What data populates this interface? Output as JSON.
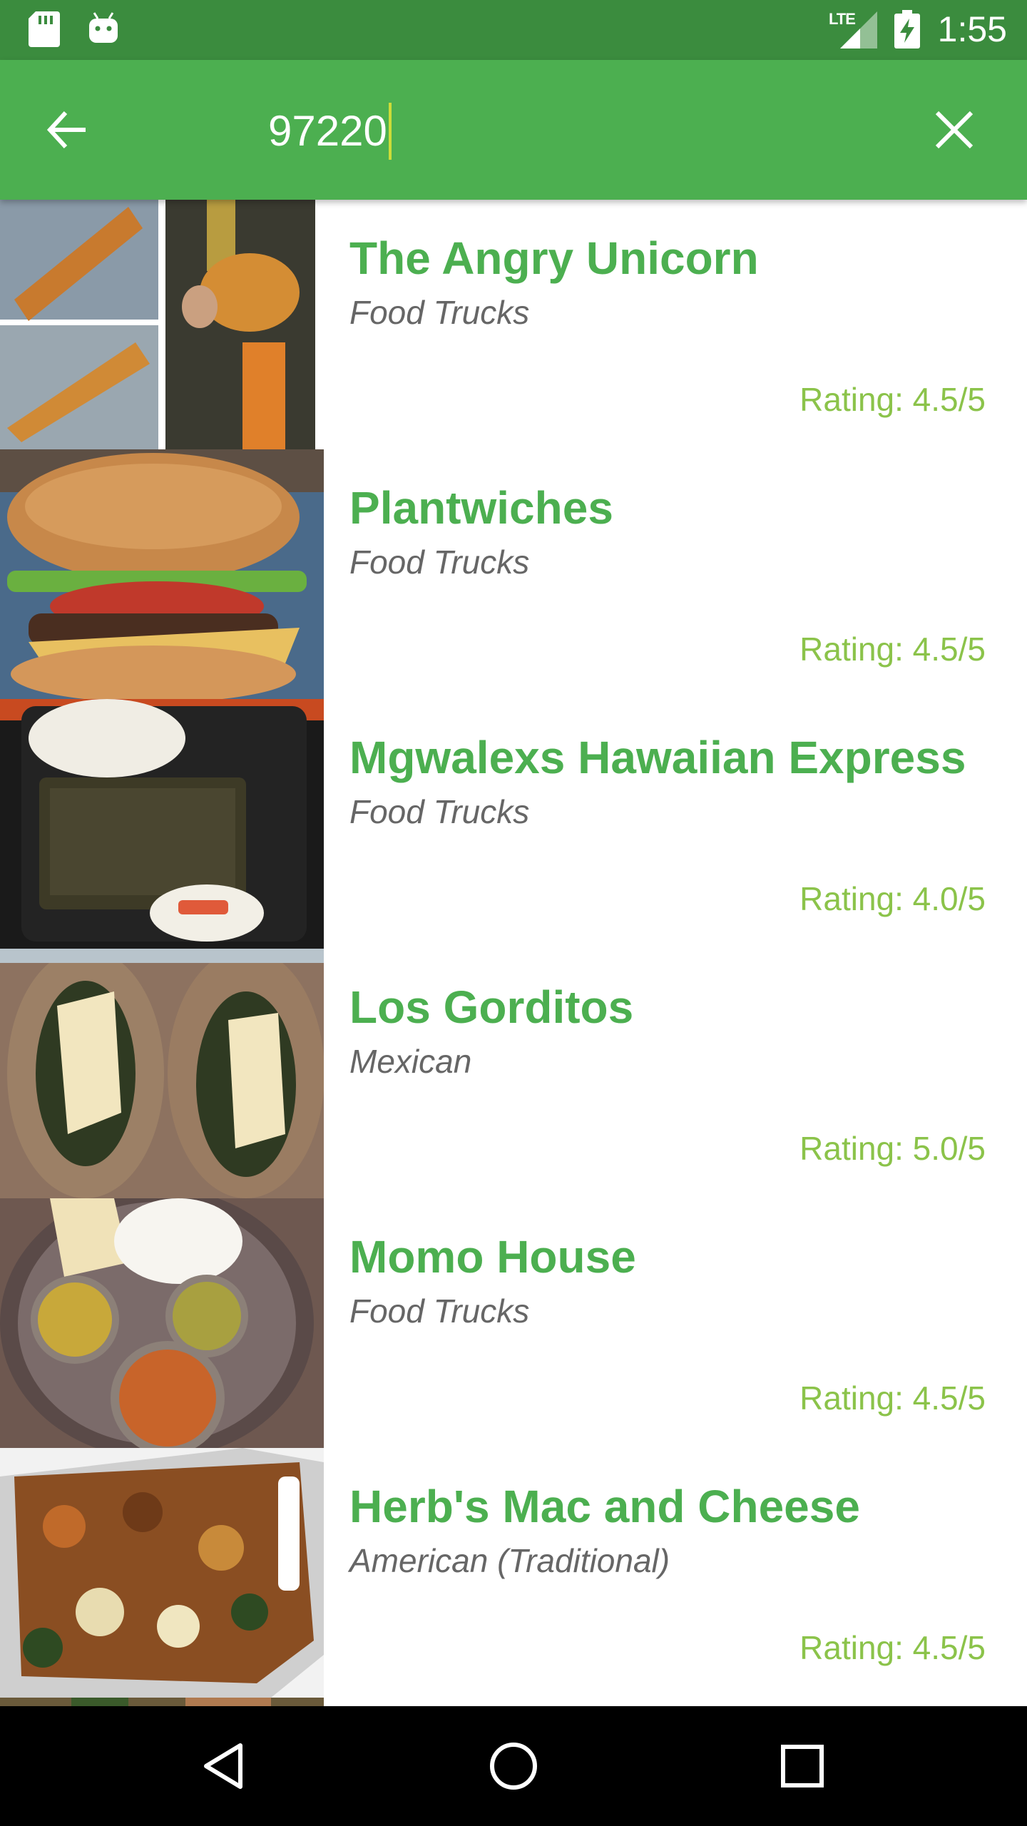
{
  "status_bar": {
    "time": "1:55",
    "network": "LTE",
    "icons": [
      "sd-card-icon",
      "android-icon",
      "signal-icon",
      "battery-charging-icon"
    ]
  },
  "search": {
    "query": "97220",
    "back_icon": "arrow-left-icon",
    "clear_icon": "close-icon"
  },
  "colors": {
    "status_bar": "#3b8c3e",
    "toolbar": "#4caf50",
    "title": "#4caf50",
    "rating": "#8bc34a",
    "caret": "#cddc39"
  },
  "results": [
    {
      "name": "The Angry Unicorn",
      "category": "Food Trucks",
      "rating": "Rating: 4.5/5"
    },
    {
      "name": "Plantwiches",
      "category": "Food Trucks",
      "rating": "Rating: 4.5/5"
    },
    {
      "name": "Mgwalexs Hawaiian Express",
      "category": "Food Trucks",
      "rating": "Rating: 4.0/5"
    },
    {
      "name": "Los Gorditos",
      "category": "Mexican",
      "rating": "Rating: 5.0/5"
    },
    {
      "name": "Momo House",
      "category": "Food Trucks",
      "rating": "Rating: 4.5/5"
    },
    {
      "name": "Herb's Mac and Cheese",
      "category": "American (Traditional)",
      "rating": "Rating: 4.5/5"
    }
  ],
  "nav_bar": {
    "icons": [
      "back-triangle-icon",
      "home-circle-icon",
      "recents-square-icon"
    ]
  }
}
